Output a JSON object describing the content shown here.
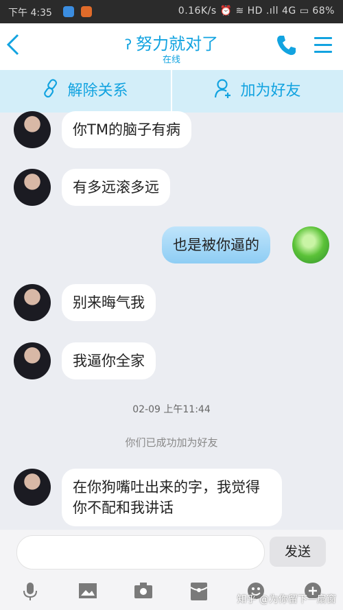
{
  "status": {
    "time": "下午 4:35",
    "right": "0.16K/s ⏰ ≋ HD .ıll 4G ▭ 68%"
  },
  "header": {
    "title": "努力就对了",
    "subtitle": "在线"
  },
  "actions": {
    "unbind": "解除关系",
    "add_friend": "加为好友"
  },
  "messages": [
    {
      "side": "left",
      "text": "你TM的脑子有病"
    },
    {
      "side": "left",
      "text": "有多远滚多远"
    },
    {
      "side": "right",
      "text": "也是被你逼的"
    },
    {
      "side": "left",
      "text": "别来晦气我"
    },
    {
      "side": "left",
      "text": "我逼你全家"
    },
    {
      "side": "left",
      "text": "在你狗嘴吐出来的字，我觉得你不配和我讲话"
    }
  ],
  "timestamp": "02-09 上午11:44",
  "system_message": "你们已成功加为好友",
  "composer": {
    "placeholder": "",
    "send_label": "发送"
  },
  "watermark": "知乎 @为你留下一扇窗",
  "colors": {
    "accent": "#12a3e0",
    "action_bg": "#d3eef9"
  }
}
